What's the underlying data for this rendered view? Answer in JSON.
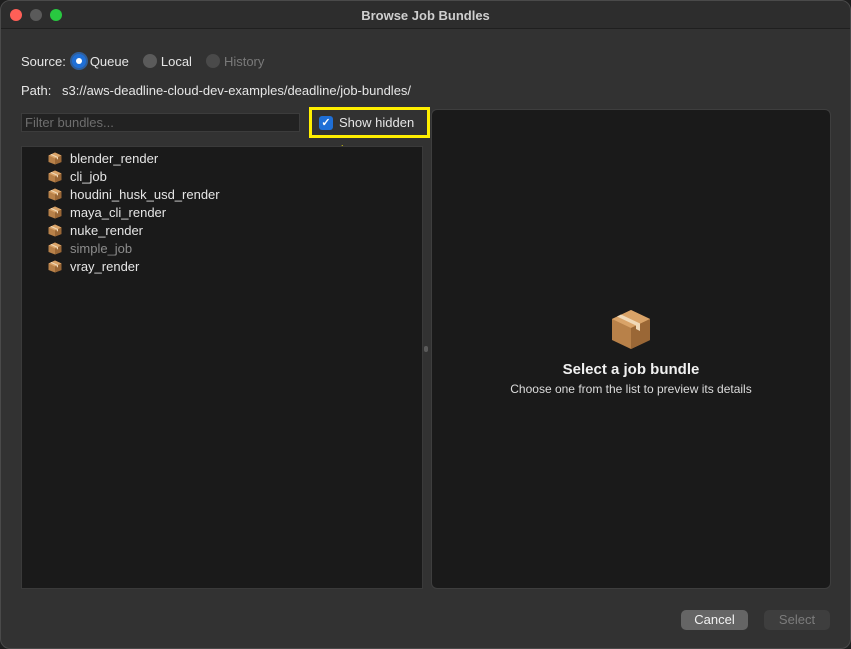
{
  "window": {
    "title": "Browse Job Bundles"
  },
  "source": {
    "label": "Source:",
    "options": [
      {
        "label": "Queue",
        "selected": true,
        "enabled": true
      },
      {
        "label": "Local",
        "selected": false,
        "enabled": true
      },
      {
        "label": "History",
        "selected": false,
        "enabled": false
      }
    ]
  },
  "path": {
    "label": "Path:",
    "value": "s3://aws-deadline-cloud-dev-examples/deadline/job-bundles/"
  },
  "filter": {
    "placeholder": "Filter bundles...",
    "value": ""
  },
  "show_hidden": {
    "label": "Show hidden",
    "checked": true
  },
  "bundles": [
    {
      "name": "blender_render",
      "hidden": false,
      "icon": "package-icon"
    },
    {
      "name": "cli_job",
      "hidden": false,
      "icon": "package-icon"
    },
    {
      "name": "houdini_husk_usd_render",
      "hidden": false,
      "icon": "package-icon"
    },
    {
      "name": "maya_cli_render",
      "hidden": false,
      "icon": "package-icon"
    },
    {
      "name": "nuke_render",
      "hidden": false,
      "icon": "package-icon"
    },
    {
      "name": "simple_job",
      "hidden": true,
      "icon": "package-icon"
    },
    {
      "name": "vray_render",
      "hidden": false,
      "icon": "package-icon"
    }
  ],
  "preview": {
    "icon": "package-icon",
    "title": "Select a job bundle",
    "subtitle": "Choose one from the list to preview its details"
  },
  "buttons": {
    "cancel": "Cancel",
    "select": "Select"
  },
  "colors": {
    "accent": "#1f6fd6",
    "highlight": "#ffef00"
  }
}
